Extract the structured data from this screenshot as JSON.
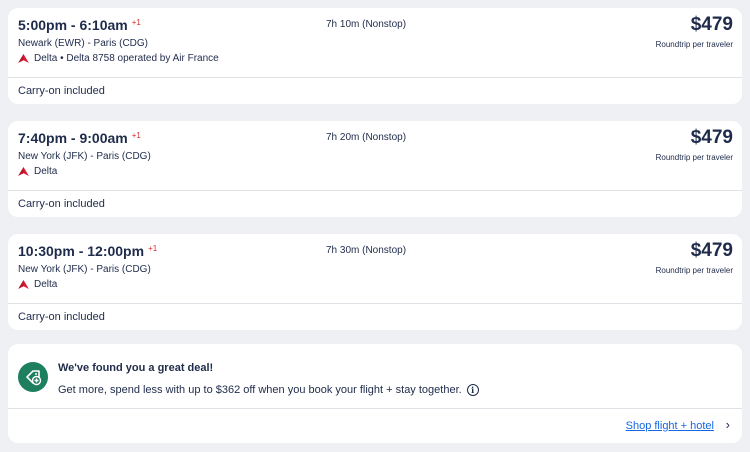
{
  "flights": [
    {
      "times": "5:00pm - 6:10am",
      "day_offset": "+1",
      "route": "Newark (EWR) - Paris (CDG)",
      "airline": "Delta • Delta 8758 operated by Air France",
      "duration": "7h 10m (Nonstop)",
      "price": "$479",
      "price_note": "Roundtrip per traveler",
      "baggage": "Carry-on included"
    },
    {
      "times": "7:40pm - 9:00am",
      "day_offset": "+1",
      "route": "New York (JFK) - Paris (CDG)",
      "airline": "Delta",
      "duration": "7h 20m (Nonstop)",
      "price": "$479",
      "price_note": "Roundtrip per traveler",
      "baggage": "Carry-on included"
    },
    {
      "times": "10:30pm - 12:00pm",
      "day_offset": "+1",
      "route": "New York (JFK) - Paris (CDG)",
      "airline": "Delta",
      "duration": "7h 30m (Nonstop)",
      "price": "$479",
      "price_note": "Roundtrip per traveler",
      "baggage": "Carry-on included"
    }
  ],
  "deal": {
    "title": "We've found you a great deal!",
    "text": "Get more, spend less with up to $362 off when you book your flight + stay together.",
    "link": "Shop flight + hotel"
  },
  "colors": {
    "delta_red": "#e01933",
    "deal_green": "#1e7f5e",
    "link_blue": "#1668e3",
    "day_offset_red": "#d32f2f"
  },
  "icons": {
    "airline": "delta-logo-icon",
    "deal": "package-deal-icon",
    "info": "info-icon",
    "link": "chevron-right-icon"
  }
}
